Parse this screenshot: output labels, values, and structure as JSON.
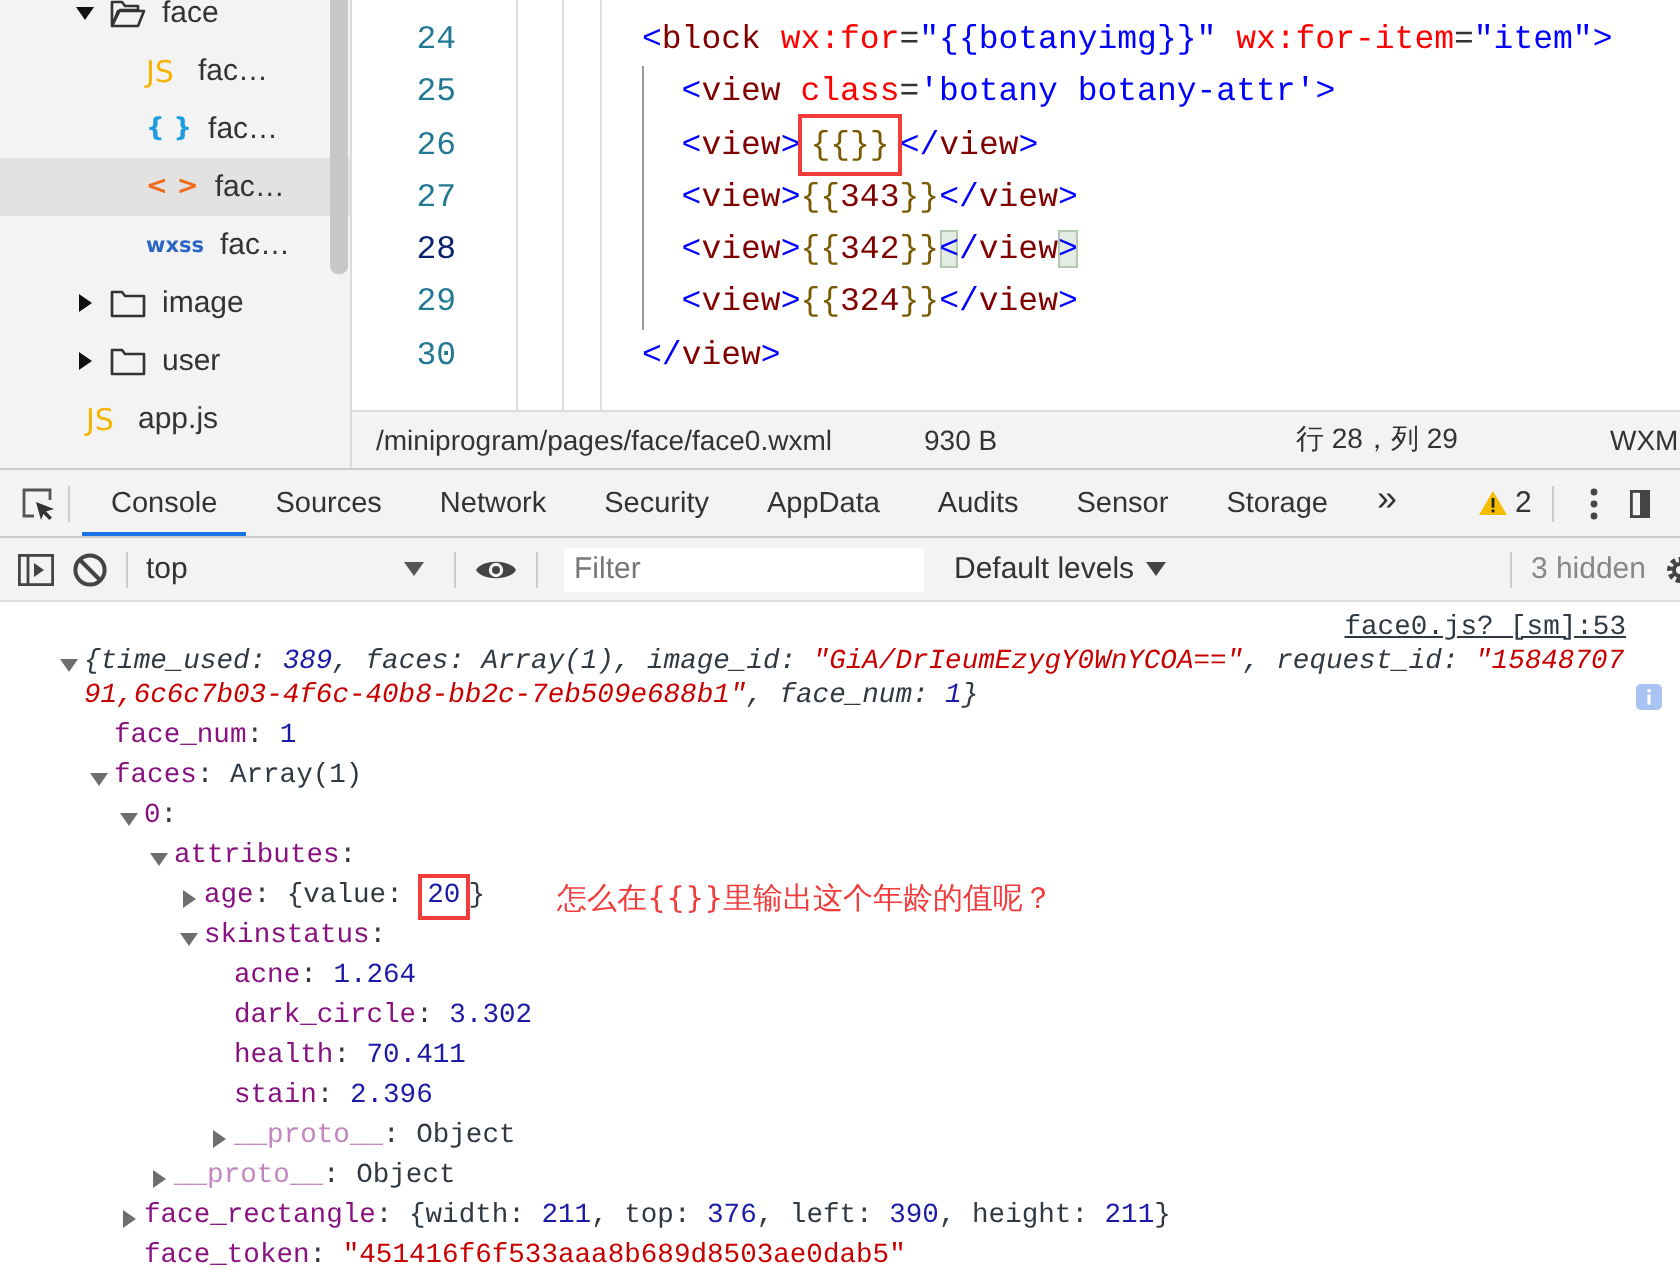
{
  "sidebar": {
    "items": [
      {
        "kind": "folder",
        "label": "face",
        "expanded": true,
        "children": [
          {
            "kind": "js-file",
            "icon": "JS",
            "label": "fac…",
            "selected": false
          },
          {
            "kind": "json-file",
            "icon": "{ }",
            "label": "fac…",
            "selected": false
          },
          {
            "kind": "wxml-file",
            "icon": "< >",
            "label": "fac…",
            "selected": true
          },
          {
            "kind": "wxss-file",
            "icon": "wxss",
            "label": "fac…",
            "selected": false
          }
        ]
      },
      {
        "kind": "folder",
        "label": "image",
        "expanded": false
      },
      {
        "kind": "folder",
        "label": "user",
        "expanded": false
      },
      {
        "kind": "js-file",
        "icon": "JS",
        "label": "app.js",
        "selected": false
      }
    ]
  },
  "editor": {
    "lines": [
      {
        "number": "24",
        "current": false,
        "tokens": [
          {
            "text": "<",
            "kind": "tagp"
          },
          {
            "text": "block",
            "kind": "tag"
          },
          {
            "text": " wx:for",
            "kind": "attr"
          },
          {
            "text": "=",
            "kind": "plain"
          },
          {
            "text": "\"{{botanyimg}}\"",
            "kind": "str"
          },
          {
            "text": " wx:for-item",
            "kind": "attr"
          },
          {
            "text": "=",
            "kind": "plain"
          },
          {
            "text": "\"item\"",
            "kind": "str"
          },
          {
            "text": ">",
            "kind": "tagp"
          }
        ],
        "children": [
          {
            "number": "25",
            "current": false,
            "tokens": [
              {
                "text": "<",
                "kind": "tagp"
              },
              {
                "text": "view",
                "kind": "tag"
              },
              {
                "text": " class",
                "kind": "attr"
              },
              {
                "text": "=",
                "kind": "plain"
              },
              {
                "text": "'botany botany-attr'",
                "kind": "str"
              },
              {
                "text": ">",
                "kind": "tagp"
              }
            ]
          },
          {
            "number": "26",
            "current": false,
            "tokens": [
              {
                "text": "<",
                "kind": "tagp"
              },
              {
                "text": "view",
                "kind": "tag"
              },
              {
                "text": ">",
                "kind": "tagp"
              },
              {
                "text": "{{}}",
                "kind": "brace",
                "boxed": true
              },
              {
                "text": "</",
                "kind": "tagp"
              },
              {
                "text": "view",
                "kind": "tag"
              },
              {
                "text": ">",
                "kind": "tagp"
              }
            ]
          },
          {
            "number": "27",
            "current": false,
            "tokens": [
              {
                "text": "<",
                "kind": "tagp"
              },
              {
                "text": "view",
                "kind": "tag"
              },
              {
                "text": ">",
                "kind": "tagp"
              },
              {
                "text": "{{",
                "kind": "brace"
              },
              {
                "text": "343",
                "kind": "value"
              },
              {
                "text": "}}",
                "kind": "brace"
              },
              {
                "text": "</",
                "kind": "tagp"
              },
              {
                "text": "view",
                "kind": "tag"
              },
              {
                "text": ">",
                "kind": "tagp"
              }
            ]
          },
          {
            "number": "28",
            "current": true,
            "tokens": [
              {
                "text": "<",
                "kind": "tagp"
              },
              {
                "text": "view",
                "kind": "tag"
              },
              {
                "text": ">",
                "kind": "tagp"
              },
              {
                "text": "{{",
                "kind": "brace"
              },
              {
                "text": "342",
                "kind": "value"
              },
              {
                "text": "}}",
                "kind": "brace"
              },
              {
                "text": "<",
                "kind": "tagp",
                "matched": true
              },
              {
                "text": "/",
                "kind": "tagp"
              },
              {
                "text": "view",
                "kind": "tag"
              },
              {
                "text": ">",
                "kind": "tagp",
                "matched": true
              }
            ]
          },
          {
            "number": "29",
            "current": false,
            "tokens": [
              {
                "text": "<",
                "kind": "tagp"
              },
              {
                "text": "view",
                "kind": "tag"
              },
              {
                "text": ">",
                "kind": "tagp"
              },
              {
                "text": "{{",
                "kind": "brace"
              },
              {
                "text": "324",
                "kind": "value"
              },
              {
                "text": "}}",
                "kind": "brace"
              },
              {
                "text": "</",
                "kind": "tagp"
              },
              {
                "text": "view",
                "kind": "tag"
              },
              {
                "text": ">",
                "kind": "tagp"
              }
            ]
          }
        ]
      },
      {
        "number": "30",
        "current": false,
        "tokens": [
          {
            "text": "</",
            "kind": "tagp"
          },
          {
            "text": "view",
            "kind": "tag"
          },
          {
            "text": ">",
            "kind": "tagp"
          }
        ]
      }
    ]
  },
  "status_bar": {
    "path": "/miniprogram/pages/face/face0.wxml",
    "size": "930 B",
    "position": "行 28，列 29",
    "language": "WXM"
  },
  "devtools": {
    "tabs": [
      {
        "label": "Console",
        "selected": true
      },
      {
        "label": "Sources",
        "selected": false
      },
      {
        "label": "Network",
        "selected": false
      },
      {
        "label": "Security",
        "selected": false
      },
      {
        "label": "AppData",
        "selected": false
      },
      {
        "label": "Audits",
        "selected": false
      },
      {
        "label": "Sensor",
        "selected": false
      },
      {
        "label": "Storage",
        "selected": false
      }
    ],
    "overflow": "»",
    "warnings": "2"
  },
  "console_toolbar": {
    "context": "top",
    "filter_placeholder": "Filter",
    "levels": "Default levels",
    "hidden": "3 hidden"
  },
  "console": {
    "source_link": "face0.js? [sm]:53",
    "tree": [
      {
        "kind": "summary",
        "expanded": true,
        "segments": [
          {
            "text": "{time_used: ",
            "kind": "plain"
          },
          {
            "text": "389",
            "kind": "num"
          },
          {
            "text": ", faces: Array(1), image_id: ",
            "kind": "plain"
          },
          {
            "text": "\"GiA/DrIeumEzygY0WnYCOA==\"",
            "kind": "str"
          },
          {
            "text": ", request_id: ",
            "kind": "plain"
          },
          {
            "text": "\"1584870791,6c6c7b03-4f6c-40b8-bb2c-7eb509e688b1\"",
            "kind": "str"
          },
          {
            "text": ", face_num: ",
            "kind": "plain"
          },
          {
            "text": "1",
            "kind": "num"
          },
          {
            "text": "}",
            "kind": "plain"
          }
        ],
        "children": [
          {
            "segments": [
              {
                "text": "face_num",
                "kind": "key"
              },
              {
                "text": ": ",
                "kind": "plain"
              },
              {
                "text": "1",
                "kind": "num"
              }
            ]
          },
          {
            "expanded": true,
            "segments": [
              {
                "text": "faces",
                "kind": "key"
              },
              {
                "text": ": Array(1)",
                "kind": "plain"
              }
            ],
            "children": [
              {
                "expanded": true,
                "segments": [
                  {
                    "text": "0",
                    "kind": "key"
                  },
                  {
                    "text": ":",
                    "kind": "plain"
                  }
                ],
                "children": [
                  {
                    "expanded": true,
                    "segments": [
                      {
                        "text": "attributes",
                        "kind": "key"
                      },
                      {
                        "text": ":",
                        "kind": "plain"
                      }
                    ],
                    "children": [
                      {
                        "expanded": false,
                        "segments": [
                          {
                            "text": "age",
                            "kind": "key"
                          },
                          {
                            "text": ": {value: ",
                            "kind": "plain"
                          },
                          {
                            "text": "20",
                            "kind": "num",
                            "boxed": true
                          },
                          {
                            "text": "}",
                            "kind": "plain"
                          }
                        ],
                        "note": "怎么在{{}}里输出这个年龄的值呢？"
                      },
                      {
                        "expanded": true,
                        "segments": [
                          {
                            "text": "skinstatus",
                            "kind": "key"
                          },
                          {
                            "text": ":",
                            "kind": "plain"
                          }
                        ],
                        "children": [
                          {
                            "segments": [
                              {
                                "text": "acne",
                                "kind": "key"
                              },
                              {
                                "text": ": ",
                                "kind": "plain"
                              },
                              {
                                "text": "1.264",
                                "kind": "num"
                              }
                            ]
                          },
                          {
                            "segments": [
                              {
                                "text": "dark_circle",
                                "kind": "key"
                              },
                              {
                                "text": ": ",
                                "kind": "plain"
                              },
                              {
                                "text": "3.302",
                                "kind": "num"
                              }
                            ]
                          },
                          {
                            "segments": [
                              {
                                "text": "health",
                                "kind": "key"
                              },
                              {
                                "text": ": ",
                                "kind": "plain"
                              },
                              {
                                "text": "70.411",
                                "kind": "num"
                              }
                            ]
                          },
                          {
                            "segments": [
                              {
                                "text": "stain",
                                "kind": "key"
                              },
                              {
                                "text": ": ",
                                "kind": "plain"
                              },
                              {
                                "text": "2.396",
                                "kind": "num"
                              }
                            ]
                          },
                          {
                            "expanded": false,
                            "segments": [
                              {
                                "text": "__proto__",
                                "kind": "proto"
                              },
                              {
                                "text": ": Object",
                                "kind": "plain"
                              }
                            ]
                          }
                        ]
                      }
                    ]
                  },
                  {
                    "expanded": false,
                    "segments": [
                      {
                        "text": "__proto__",
                        "kind": "proto"
                      },
                      {
                        "text": ": Object",
                        "kind": "plain"
                      }
                    ]
                  }
                ]
              },
              {
                "expanded": false,
                "segments": [
                  {
                    "text": "face_rectangle",
                    "kind": "key"
                  },
                  {
                    "text": ": {width: ",
                    "kind": "plain"
                  },
                  {
                    "text": "211",
                    "kind": "num"
                  },
                  {
                    "text": ", top: ",
                    "kind": "plain"
                  },
                  {
                    "text": "376",
                    "kind": "num"
                  },
                  {
                    "text": ", left: ",
                    "kind": "plain"
                  },
                  {
                    "text": "390",
                    "kind": "num"
                  },
                  {
                    "text": ", height: ",
                    "kind": "plain"
                  },
                  {
                    "text": "211",
                    "kind": "num"
                  },
                  {
                    "text": "}",
                    "kind": "plain"
                  }
                ]
              },
              {
                "segments": [
                  {
                    "text": "face_token",
                    "kind": "key"
                  },
                  {
                    "text": ": ",
                    "kind": "plain"
                  },
                  {
                    "text": "\"451416f6f533aaa8b689d8503ae0dab5\"",
                    "kind": "str"
                  }
                ]
              }
            ]
          }
        ]
      }
    ]
  }
}
